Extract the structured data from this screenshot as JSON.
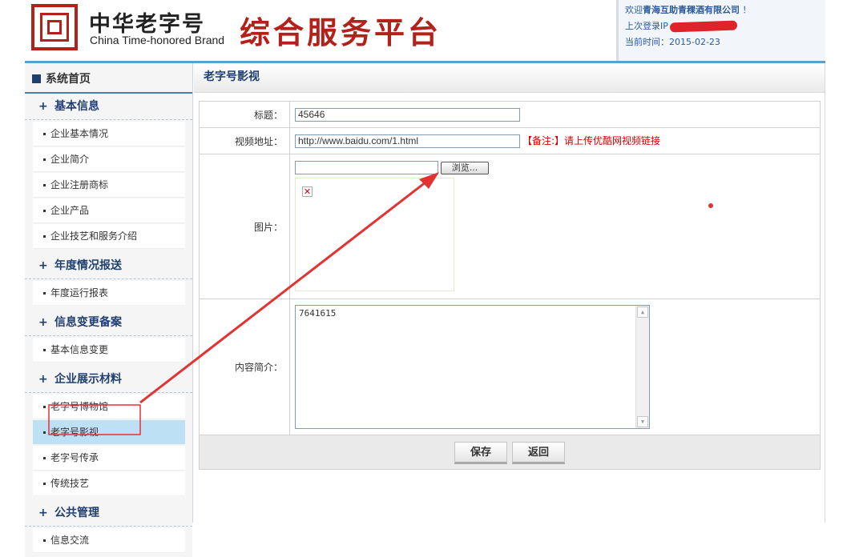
{
  "header": {
    "logo_cn": "中华老字号",
    "logo_en": "China Time-honored Brand",
    "platform_title": "综合服务平台",
    "welcome_prefix": "欢迎",
    "company": "青海互助青稞酒有限公司",
    "welcome_suffix": " ！",
    "last_login_label": "上次登录IP",
    "current_time_label": "当前时间：",
    "current_time": "2015-02-23"
  },
  "sidebar": {
    "home": "系统首页",
    "groups": [
      {
        "label": "基本信息",
        "items": [
          "企业基本情况",
          "企业简介",
          "企业注册商标",
          "企业产品",
          "企业技艺和服务介绍"
        ]
      },
      {
        "label": "年度情况报送",
        "items": [
          "年度运行报表"
        ]
      },
      {
        "label": "信息变更备案",
        "items": [
          "基本信息变更"
        ]
      },
      {
        "label": "企业展示材料",
        "items": [
          "老字号博物馆",
          "老字号影视",
          "老字号传承",
          "传统技艺"
        ]
      },
      {
        "label": "公共管理",
        "items": [
          "信息交流"
        ]
      }
    ],
    "active_item": "老字号影视"
  },
  "main": {
    "title": "老字号影视",
    "form": {
      "title_label": "标题：",
      "title_value": "45646",
      "video_label": "视频地址：",
      "video_value": "http://www.baidu.com/1.html",
      "video_note": "【备注:】请上传优酷网视频链接",
      "image_label": "图片：",
      "browse_label": "浏览...",
      "content_label": "内容简介：",
      "content_value": "7641615"
    },
    "buttons": {
      "save": "保存",
      "back": "返回"
    }
  },
  "colors": {
    "brand_red": "#b3211b",
    "nav_blue": "#1f3f6f",
    "active_bg": "#bde0f5",
    "annotation_red": "#e23333"
  }
}
